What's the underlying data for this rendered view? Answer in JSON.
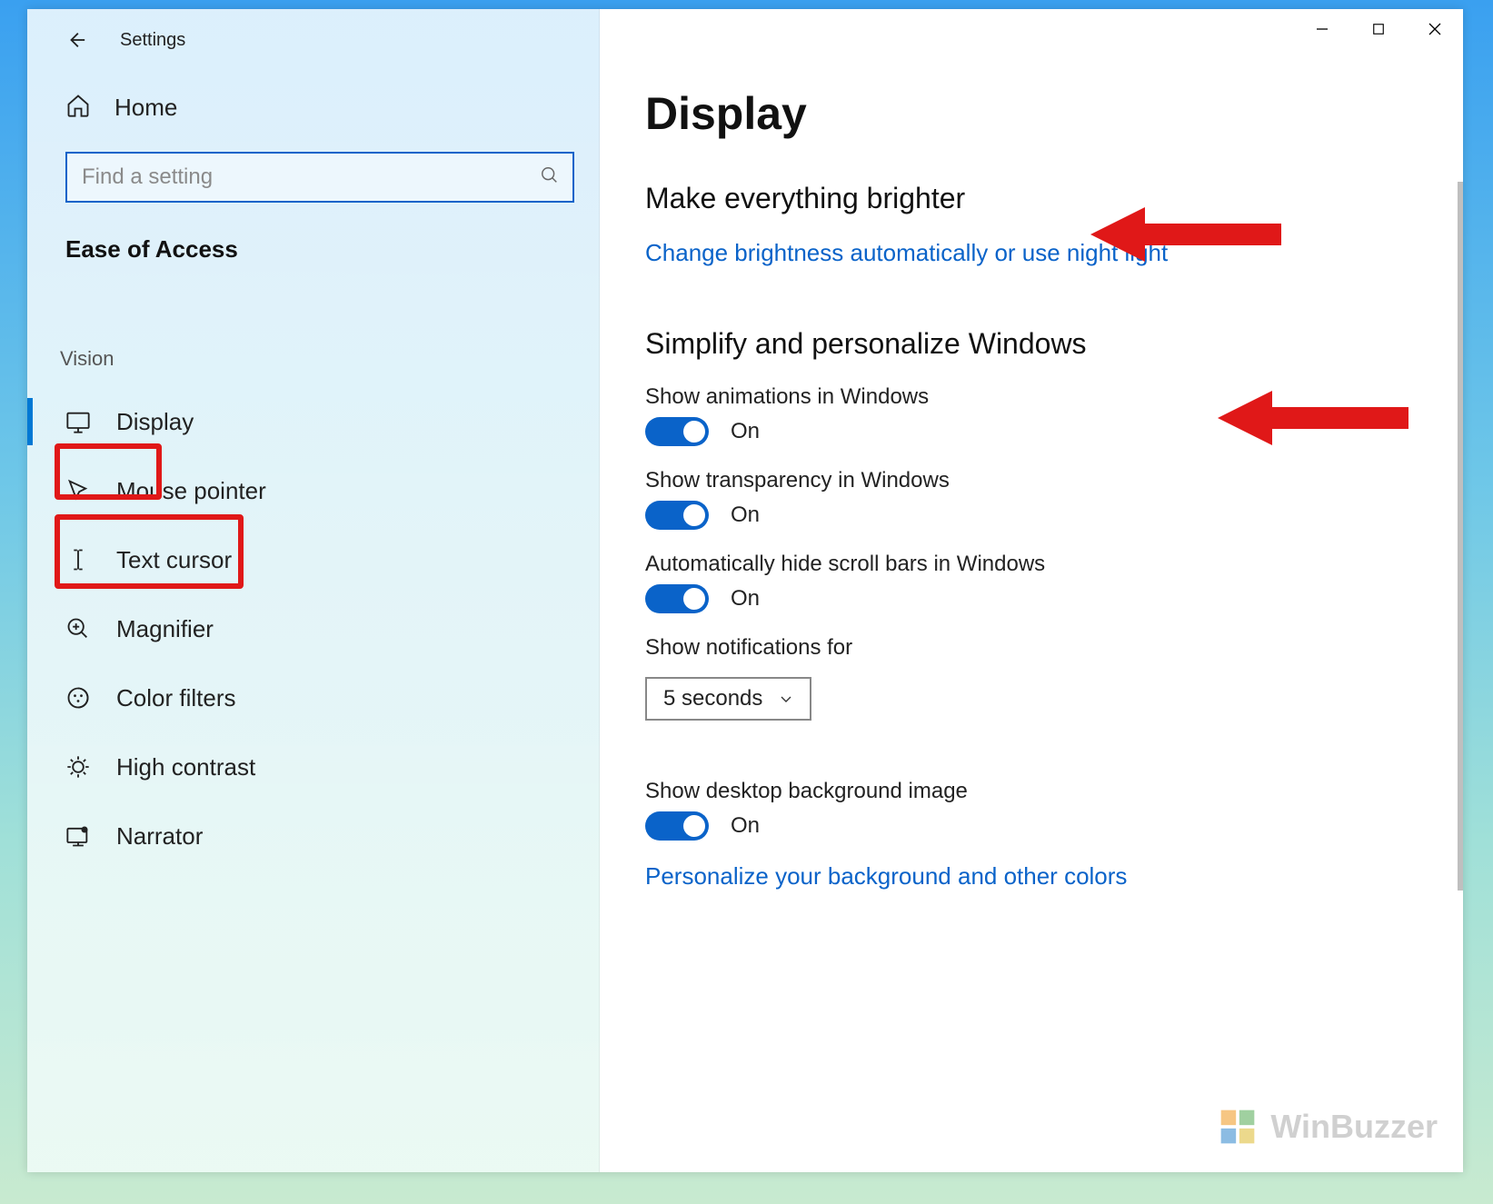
{
  "window": {
    "app_title": "Settings"
  },
  "sidebar": {
    "home_label": "Home",
    "search_placeholder": "Find a setting",
    "section_title": "Ease of Access",
    "group_label": "Vision",
    "items": [
      {
        "label": "Display"
      },
      {
        "label": "Mouse pointer"
      },
      {
        "label": "Text cursor"
      },
      {
        "label": "Magnifier"
      },
      {
        "label": "Color filters"
      },
      {
        "label": "High contrast"
      },
      {
        "label": "Narrator"
      }
    ]
  },
  "main": {
    "page_title": "Display",
    "section1_title": "Make everything brighter",
    "link1": "Change brightness automatically or use night light",
    "section2_title": "Simplify and personalize Windows",
    "settings": {
      "animations_label": "Show animations in Windows",
      "animations_state": "On",
      "transparency_label": "Show transparency in Windows",
      "transparency_state": "On",
      "scrollbars_label": "Automatically hide scroll bars in Windows",
      "scrollbars_state": "On",
      "notifications_label": "Show notifications for",
      "notifications_value": "5 seconds",
      "desktop_bg_label": "Show desktop background image",
      "desktop_bg_state": "On"
    },
    "link2": "Personalize your background and other colors"
  },
  "watermark": "WinBuzzer"
}
